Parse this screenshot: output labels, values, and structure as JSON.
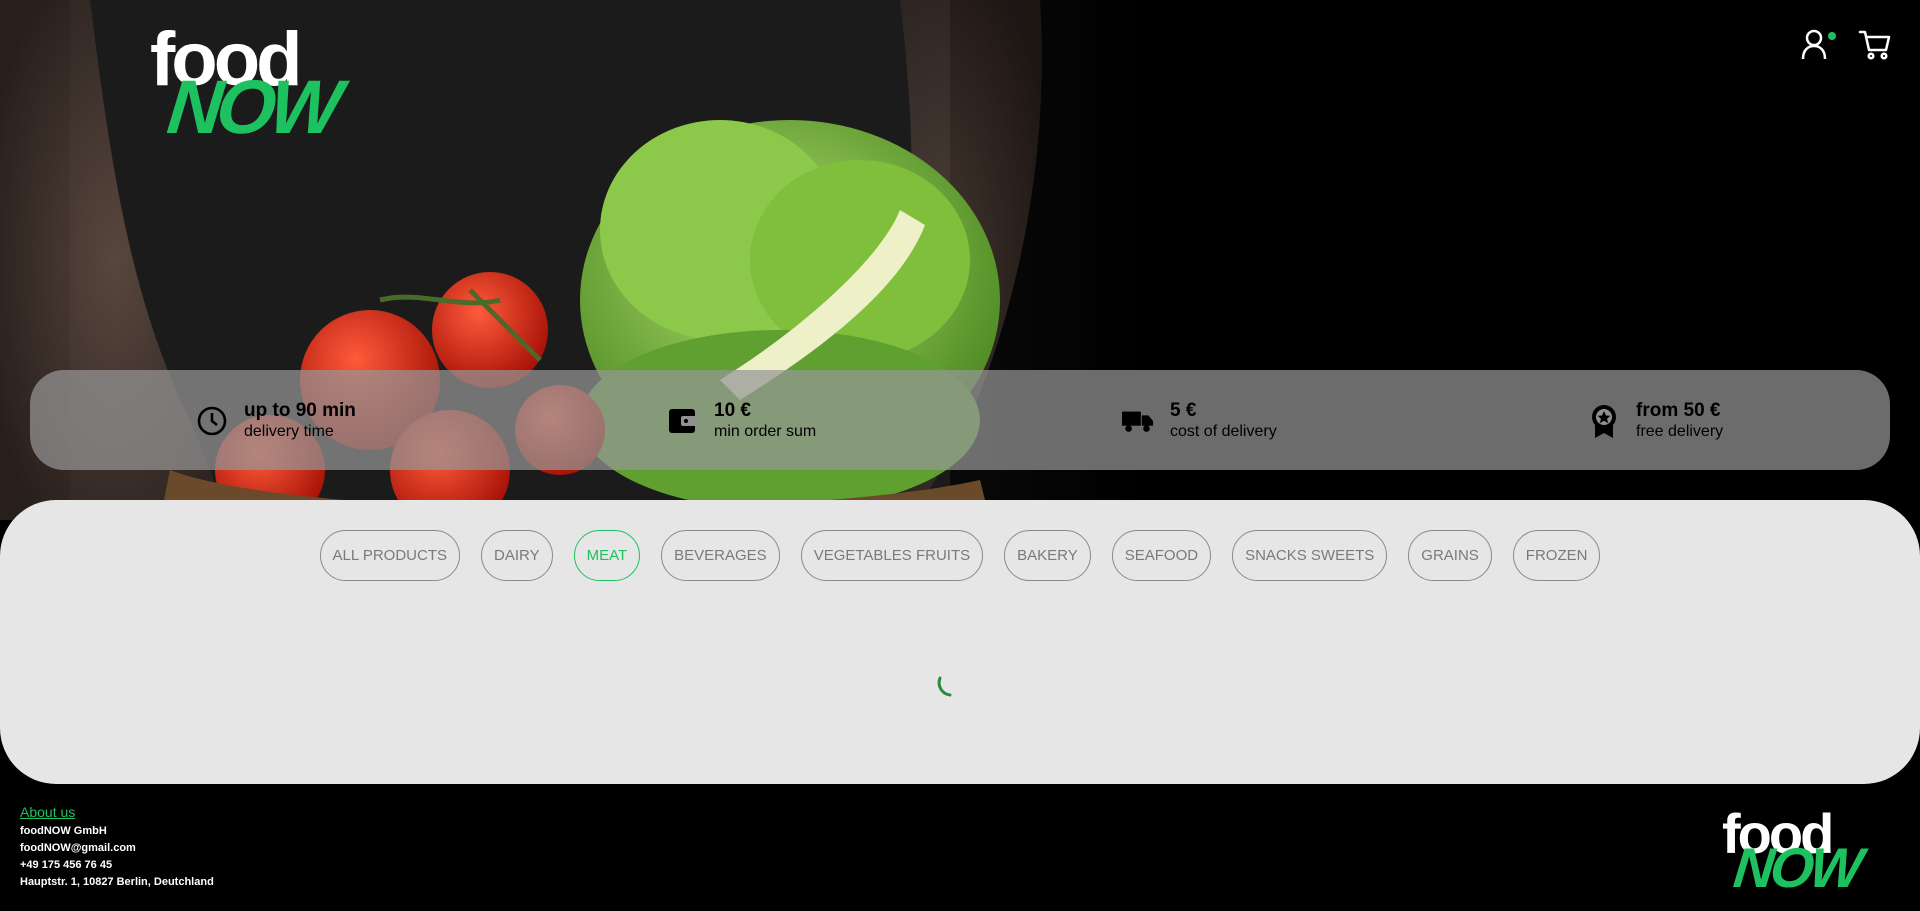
{
  "brand": {
    "logo_top": "food",
    "logo_bottom": "NOW",
    "accent": "#1ec15f"
  },
  "header": {
    "user_icon": "user-icon",
    "cart_icon": "cart-icon",
    "user_status_color": "#1ec15f"
  },
  "info": [
    {
      "icon": "clock-icon",
      "title": "up to 90 min",
      "subtitle": "delivery time"
    },
    {
      "icon": "wallet-icon",
      "title": "10 €",
      "subtitle": "min order sum"
    },
    {
      "icon": "truck-icon",
      "title": "5 €",
      "subtitle": "cost of delivery"
    },
    {
      "icon": "award-icon",
      "title": "from 50 €",
      "subtitle": "free delivery"
    }
  ],
  "categories": [
    "ALL PRODUCTS",
    "DAIRY",
    "MEAT",
    "BEVERAGES",
    "VEGETABLES FRUITS",
    "BAKERY",
    "SEAFOOD",
    "SNACKS SWEETS",
    "GRAINS",
    "FROZEN"
  ],
  "active_category": "MEAT",
  "footer": {
    "about": "About us",
    "company": "foodNOW GmbH",
    "email": "foodNOW@gmail.com",
    "phone": "+49 175 456 76 45",
    "address": "Hauptstr. 1, 10827 Berlin, Deutchland"
  }
}
